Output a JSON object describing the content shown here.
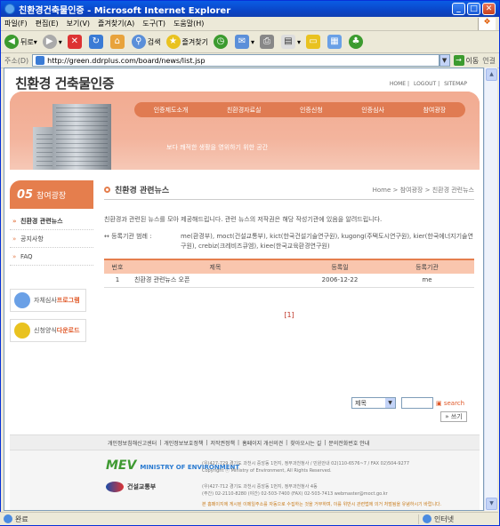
{
  "window": {
    "title": "친환경건축물인증 - Microsoft Internet Explorer"
  },
  "menu": [
    "파일(F)",
    "편집(E)",
    "보기(V)",
    "즐겨찾기(A)",
    "도구(T)",
    "도움말(H)"
  ],
  "toolbar": {
    "back": "뒤로",
    "search": "검색",
    "favorites": "즐겨찾기"
  },
  "address": {
    "label": "주소(D)",
    "url": "http://green.ddrplus.com/board/news/list.jsp",
    "go": "이동",
    "links": "연결"
  },
  "site": {
    "logo": "친환경 건축물인증",
    "toplinks": [
      "HOME",
      "LOGOUT",
      "SITEMAP"
    ],
    "nav": [
      "인증제도소개",
      "친환경자료실",
      "인증신청",
      "인증심사",
      "참여광장"
    ],
    "slogan": "보다 쾌적한 생활을 영위하기 위한 공간"
  },
  "side": {
    "num": "05",
    "title": "참여광장",
    "menu": [
      "친환경 관련뉴스",
      "공지사항",
      "FAQ"
    ],
    "banner1": {
      "label": "자체심사 ",
      "em": "프로그램"
    },
    "banner2": {
      "label": "신청양식 ",
      "em": "다운로드"
    }
  },
  "content": {
    "title": "친환경 관련뉴스",
    "breadcrumb": "Home > 참여광장 > 친환경 관련뉴스",
    "intro": "친환경과 관련된 뉴스를 모아 제공해드립니다. 관련 뉴스의 저작권은 해당 작성기관에 있음을 알려드립니다.",
    "agencies_label": "↔ 등록기관 범례 :",
    "agencies": "me(환경부), moct(건설교통부), kict(한국건설기술연구원), kugong(주택도시연구원), kier(한국에너지기술연구원), crebiz(크레비즈큐엠), kiee(한국교육환경연구원)",
    "columns": [
      "번호",
      "제목",
      "등록일",
      "등록기관"
    ],
    "rows": [
      {
        "no": "1",
        "title": "친환경 관련뉴스 오픈",
        "date": "2006-12-22",
        "org": "me"
      }
    ],
    "pager": "[1]",
    "search_select": "제목",
    "search_btn": "search",
    "write_btn": "쓰기"
  },
  "footer": {
    "links": [
      "개인정보침해신고센터",
      "|",
      "개인정보보호정책",
      "|",
      "저작권정책",
      "|",
      "홈페이지 개선의견",
      "|",
      "찾아오시는 길",
      "|",
      "문의전화번호 안내"
    ],
    "mev_logo": "MEV",
    "mev_name": "MINISTRY OF ENVIRONMENT",
    "moct_name": "건설교통부",
    "addr1": "(우)427-729 경기도 과천시 중앙동 1번지, 정부과천청사 / 민원안내 02)110-6576~7 / FAX 02)504-9277",
    "copy1": "Copyright ⓒ Ministry of Environment, All Rights Reserved.",
    "addr2": "(우)427-712 경기도 과천시 중앙동 1번지, 정부과천청사 4동",
    "addr3": "(주간) 02-2110-8280 (야간) 02-503-7400 (FAX) 02-503-7413 webmaster@moct.go.kr",
    "note": "본 홈페이지에 게시된 이메일주소를 자동으로 수집하는 것을 거부하며, 이를 위반시 관련법에 의거 처벌됨을 유념하시기 바랍니다."
  },
  "status": {
    "text": "완료",
    "zone": "인터넷"
  }
}
